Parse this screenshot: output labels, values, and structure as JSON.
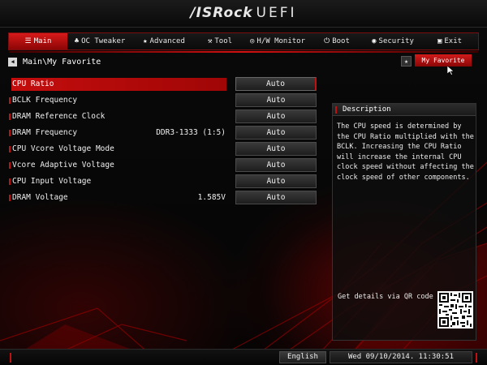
{
  "header": {
    "brand": "/ISRock",
    "product": "UEFI"
  },
  "tabs": [
    {
      "key": "main",
      "label": "Main",
      "icon": "☰",
      "icon_name": "main-icon",
      "active": true
    },
    {
      "key": "oc-tweaker",
      "label": "OC Tweaker",
      "icon": "♣",
      "icon_name": "oc-tweaker-icon",
      "active": false
    },
    {
      "key": "advanced",
      "label": "Advanced",
      "icon": "★",
      "icon_name": "advanced-icon",
      "active": false
    },
    {
      "key": "tool",
      "label": "Tool",
      "icon": "⚒",
      "icon_name": "tool-icon",
      "active": false
    },
    {
      "key": "hw-monitor",
      "label": "H/W Monitor",
      "icon": "◎",
      "icon_name": "hw-monitor-icon",
      "active": false
    },
    {
      "key": "boot",
      "label": "Boot",
      "icon": "⏻",
      "icon_name": "boot-icon",
      "active": false
    },
    {
      "key": "security",
      "label": "Security",
      "icon": "◉",
      "icon_name": "security-icon",
      "active": false
    },
    {
      "key": "exit",
      "label": "Exit",
      "icon": "▣",
      "icon_name": "exit-icon",
      "active": false
    }
  ],
  "breadcrumb": {
    "text": "Main\\My Favorite"
  },
  "favorite": {
    "label": "My Favorite",
    "star": "★"
  },
  "settings": [
    {
      "label": "CPU Ratio",
      "current": "",
      "value": "Auto",
      "selected": true
    },
    {
      "label": "BCLK Frequency",
      "current": "",
      "value": "Auto",
      "selected": false
    },
    {
      "label": "DRAM Reference Clock",
      "current": "",
      "value": "Auto",
      "selected": false
    },
    {
      "label": "DRAM Frequency",
      "current": "DDR3-1333 (1:5)",
      "value": "Auto",
      "selected": false
    },
    {
      "label": "CPU Vcore Voltage Mode",
      "current": "",
      "value": "Auto",
      "selected": false
    },
    {
      "label": "Vcore Adaptive Voltage",
      "current": "",
      "value": "Auto",
      "selected": false
    },
    {
      "label": "CPU Input Voltage",
      "current": "",
      "value": "Auto",
      "selected": false
    },
    {
      "label": "DRAM Voltage",
      "current": "1.585V",
      "value": "Auto",
      "selected": false
    }
  ],
  "description": {
    "title": "Description",
    "text": "The CPU speed is determined by the CPU Ratio multiplied with the BCLK. Increasing the CPU Ratio will increase the internal CPU clock speed without affecting the clock speed of other components.",
    "qr_label": "Get details via QR code"
  },
  "footer": {
    "language": "English",
    "datetime": "Wed 09/10/2014. 11:30:51"
  },
  "colors": {
    "accent": "#c40d0d",
    "background": "#060606",
    "value_box": "#2b2b2b"
  }
}
